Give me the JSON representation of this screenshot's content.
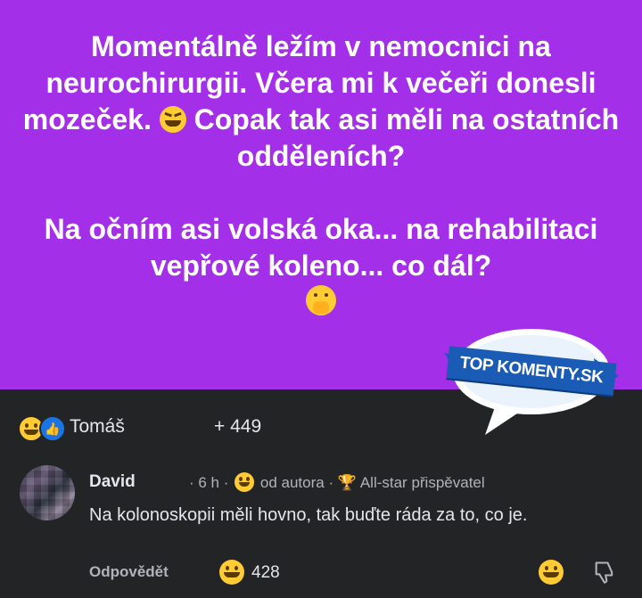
{
  "post": {
    "paragraph1": "Momentálně ležím v nemocnici na neurochirurgii. Včera mi k večeři donesli mozeček.",
    "paragraph1_tail": "Copak tak asi měli na ostatních odděleních?",
    "paragraph2": "Na očním asi volská oka... na rehabilitaci vepřové koleno... co dál?",
    "background_color": "#a42fe8",
    "emojis": [
      "grinning-squinting-face",
      "face-with-hand-over-mouth"
    ]
  },
  "logo": {
    "text": "TOP KOMENTY.SK"
  },
  "reactions_bar": {
    "author": "Tomáš",
    "count": "+ 449",
    "icons": [
      "haha-reaction-icon",
      "like-reaction-icon"
    ]
  },
  "comment": {
    "author": "David",
    "time": "· 6 h ·",
    "from_author": "od autora",
    "separator": "·",
    "badge": "All-star přispěvatel",
    "text": "Na kolonoskopii měli hovno, tak buďte ráda za to, co je.",
    "reply_label": "Odpovědět",
    "reaction_count": "428"
  }
}
